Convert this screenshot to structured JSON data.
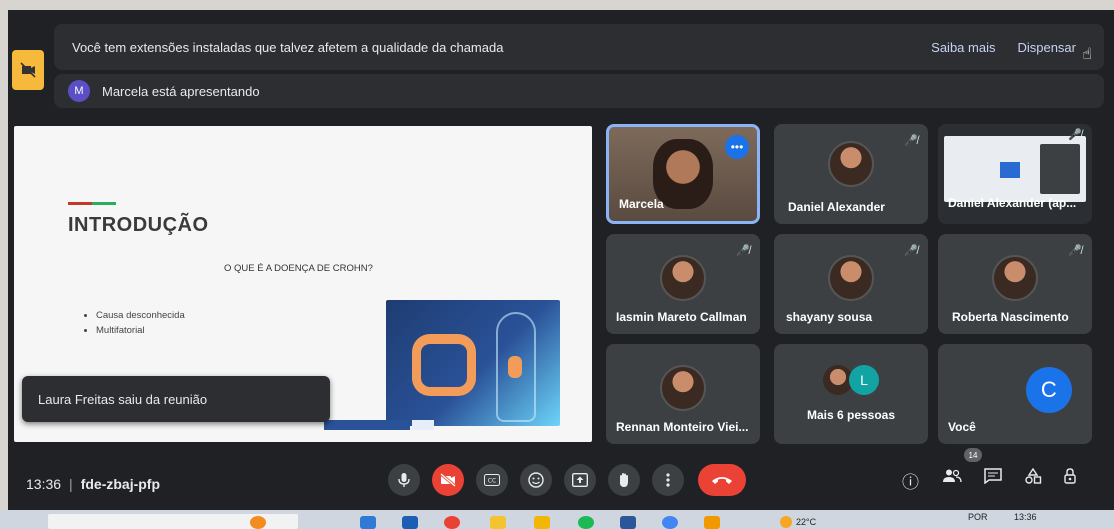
{
  "banner": {
    "message": "Você tem extensões instaladas que talvez afetem a qualidade da chamada",
    "learn_more": "Saiba mais",
    "dismiss": "Dispensar"
  },
  "presenting": {
    "avatar_initial": "M",
    "text": "Marcela está apresentando"
  },
  "slide": {
    "title": "INTRODUÇÃO",
    "subtitle": "O QUE É A DOENÇA DE CROHN?",
    "bullets": [
      "Causa desconhecida",
      "Multifatorial"
    ]
  },
  "toast": {
    "text": "Laura Freitas saiu da reunião"
  },
  "participants": [
    {
      "name": "Marcela"
    },
    {
      "name": "Daniel Alexander"
    },
    {
      "name": "Daniel Alexander (ap..."
    },
    {
      "name": "Iasmin Mareto Callman"
    },
    {
      "name": "shayany sousa"
    },
    {
      "name": "Roberta Nascimento"
    },
    {
      "name": "Rennan Monteiro Viei..."
    },
    {
      "name": "Mais 6 pessoas",
      "avatar_initial": "L"
    },
    {
      "name": "Você",
      "avatar_initial": "C"
    }
  ],
  "meeting": {
    "time": "13:36",
    "separator": "|",
    "code": "fde-zbaj-pfp",
    "participant_count": "14"
  },
  "taskbar": {
    "temperature": "22°C",
    "language": "POR",
    "clock": "13:36"
  },
  "colors": {
    "accent": "#8ab4f8",
    "hangup": "#ea4335",
    "you_avatar": "#1a73e8"
  }
}
